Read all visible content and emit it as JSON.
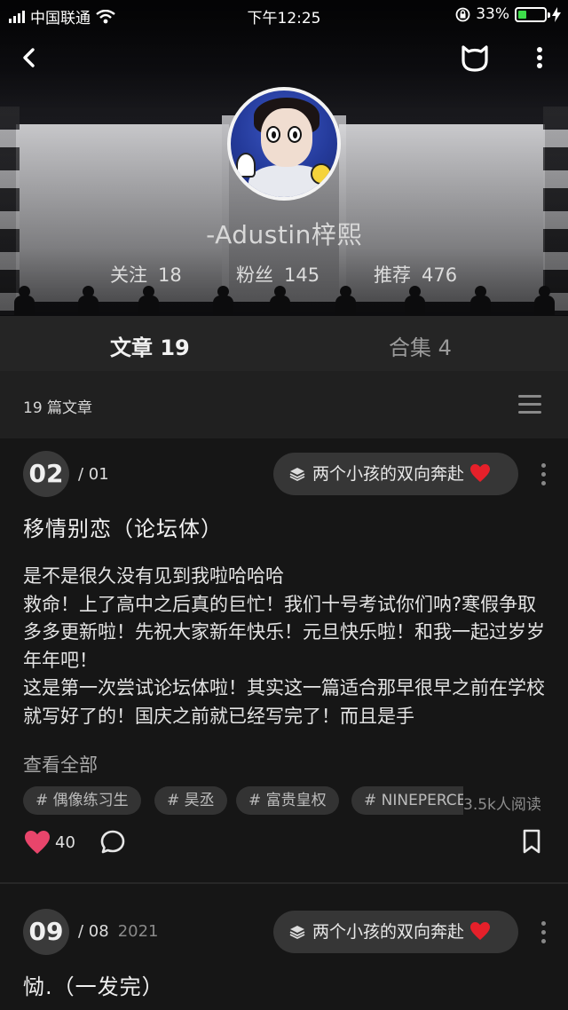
{
  "status_bar": {
    "carrier": "中国联通",
    "time": "下午12:25",
    "battery": "33%",
    "battery_level": 0.33
  },
  "profile": {
    "nickname": "-Adustin梓熙",
    "stats": [
      {
        "label": "关注",
        "value": "18"
      },
      {
        "label": "粉丝",
        "value": "145"
      },
      {
        "label": "推荐",
        "value": "476"
      }
    ]
  },
  "tabs": [
    {
      "label": "文章 19",
      "active": true
    },
    {
      "label": "合集 4",
      "active": false
    }
  ],
  "count_label": "19 篇文章",
  "articles": [
    {
      "number": "02",
      "sub_number": "/ 01",
      "year": "",
      "collection": "两个小孩的双向奔赴",
      "title": "移情别恋（论坛体）",
      "body": [
        "是不是很久没有见到我啦哈哈哈",
        "救命！上了高中之后真的巨忙！我们十号考试你们呐?寒假争取多多更新啦！先祝大家新年快乐！元旦快乐啦！和我一起过岁岁年年吧！",
        "这是第一次尝试论坛体啦！其实这一篇适合那早很早之前在学校就写好了的！国庆之前就已经写完了！而且是手"
      ],
      "more_label": "查看全部",
      "tags": [
        "# 偶像练习生",
        "# 昊丞",
        "# 富贵皇权",
        "# NINEPERCENT"
      ],
      "reads": "3.5k人阅读",
      "likes": "40"
    },
    {
      "number": "09",
      "sub_number": "/ 08",
      "year": "2021",
      "collection": "两个小孩的双向奔赴",
      "title": "恸.（一发完）"
    }
  ],
  "colors": {
    "background": "#161616",
    "heart": "#e8456b",
    "battery_fill": "#3ddc4a"
  },
  "icons": [
    "back-icon",
    "cat-ears-icon",
    "more-vertical-icon",
    "list-menu-icon",
    "layers-icon",
    "heart-icon",
    "comment-icon",
    "bookmark-icon",
    "wifi-icon",
    "lock-rotation-icon",
    "charging-icon"
  ]
}
